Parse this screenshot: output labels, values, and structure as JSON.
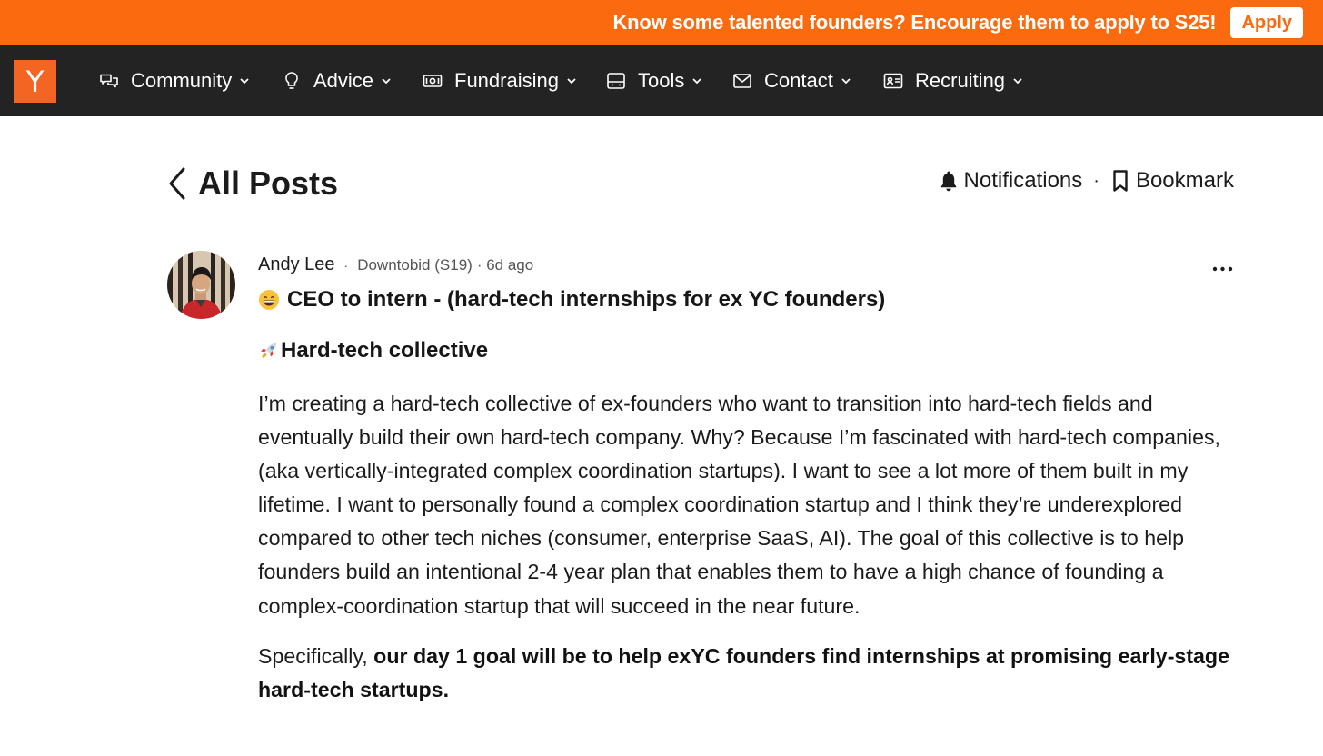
{
  "banner": {
    "text": "Know some talented founders? Encourage them to apply to S25!",
    "apply_label": "Apply"
  },
  "nav": {
    "logo": "Y",
    "items": [
      {
        "label": "Community",
        "icon": "chat-bubbles-icon"
      },
      {
        "label": "Advice",
        "icon": "lightbulb-icon"
      },
      {
        "label": "Fundraising",
        "icon": "money-icon"
      },
      {
        "label": "Tools",
        "icon": "tray-icon"
      },
      {
        "label": "Contact",
        "icon": "envelope-icon"
      },
      {
        "label": "Recruiting",
        "icon": "id-card-icon"
      }
    ]
  },
  "header": {
    "title": "All Posts",
    "notifications_label": "Notifications",
    "separator": "·",
    "bookmark_label": "Bookmark"
  },
  "post": {
    "author": "Andy Lee",
    "separator": "·",
    "company": "Downtobid (S19)",
    "time": "· 6d ago",
    "title": "CEO to intern - (hard-tech internships for ex YC founders)",
    "subheading": "Hard-tech collective",
    "paragraph1": "I’m creating a hard-tech collective of ex-founders who want to transition into hard-tech fields and eventually build their own hard-tech company. Why? Because I’m fascinated with hard-tech companies, (aka vertically-integrated complex coordination startups). I want to see a lot more of them built in my lifetime. I want to personally found a complex coordination startup and I think they’re underexplored compared to other tech niches (consumer, enterprise SaaS, AI). The goal of this collective is to help founders build an intentional 2-4 year plan that enables them to have a high chance of founding a complex-coordination startup that will succeed in the near future.",
    "paragraph2_lead": "Specifically, ",
    "paragraph2_bold": "our day 1 goal will be to help exYC founders find internships at promising early-stage hard-tech startups."
  },
  "colors": {
    "brand_orange": "#fc6a0f",
    "nav_bg": "#232323"
  }
}
